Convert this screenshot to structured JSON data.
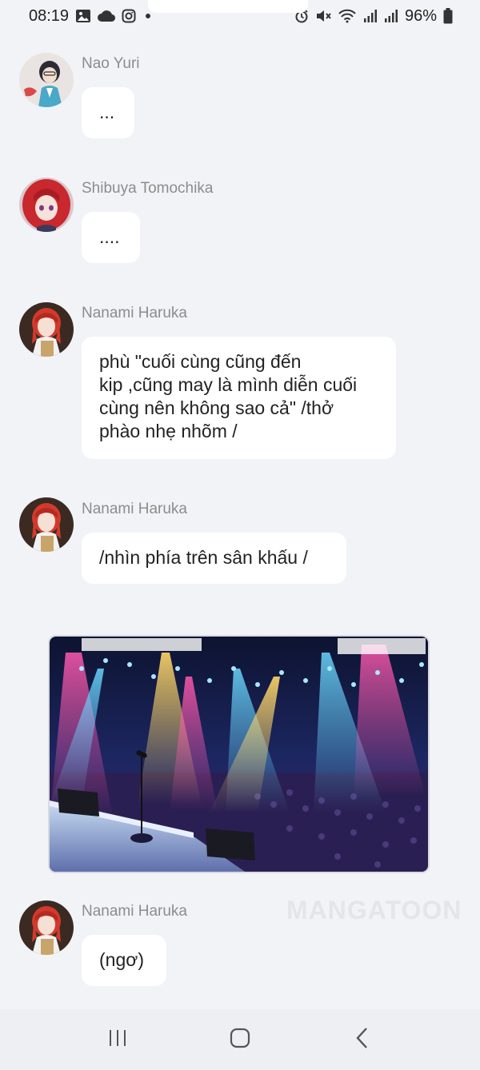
{
  "status_bar": {
    "time": "08:19",
    "battery": "96%",
    "left_icons": [
      "gallery-icon",
      "cloud-icon",
      "instagram-icon",
      "dot-icon"
    ],
    "right_icons": [
      "alarm-icon",
      "mute-icon",
      "wifi-icon",
      "signal-icon",
      "signal-icon",
      "battery-icon"
    ]
  },
  "messages": [
    {
      "sender": "Nao Yuri",
      "text": "...",
      "avatar": "nao-yuri-avatar"
    },
    {
      "sender": "Shibuya Tomochika",
      "text": "....",
      "avatar": "shibuya-tomochika-avatar"
    },
    {
      "sender": "Nanami Haruka",
      "text": "phù \"cuối cùng cũng đến\nkip ,cũng may là mình diễn cuối\ncùng nên không sao cả\" /thở\nphào nhẹ nhõm /",
      "avatar": "nanami-haruka-avatar"
    },
    {
      "sender": "Nanami Haruka",
      "text": "/nhìn phía trên sân khấu /",
      "avatar": "nanami-haruka-avatar"
    },
    {
      "sender": "Nanami Haruka",
      "text": "(ngơ)",
      "avatar": "nanami-haruka-avatar"
    }
  ],
  "image": {
    "alt": "concert-stage-image"
  },
  "watermark": "MANGATOON",
  "nav": {
    "recent": "recent-apps-icon",
    "home": "home-icon",
    "back": "back-icon"
  },
  "colors": {
    "background": "#f2f3f7",
    "bubble": "#ffffff",
    "sender": "#8c8c8c",
    "accent_red": "#c8282e"
  }
}
